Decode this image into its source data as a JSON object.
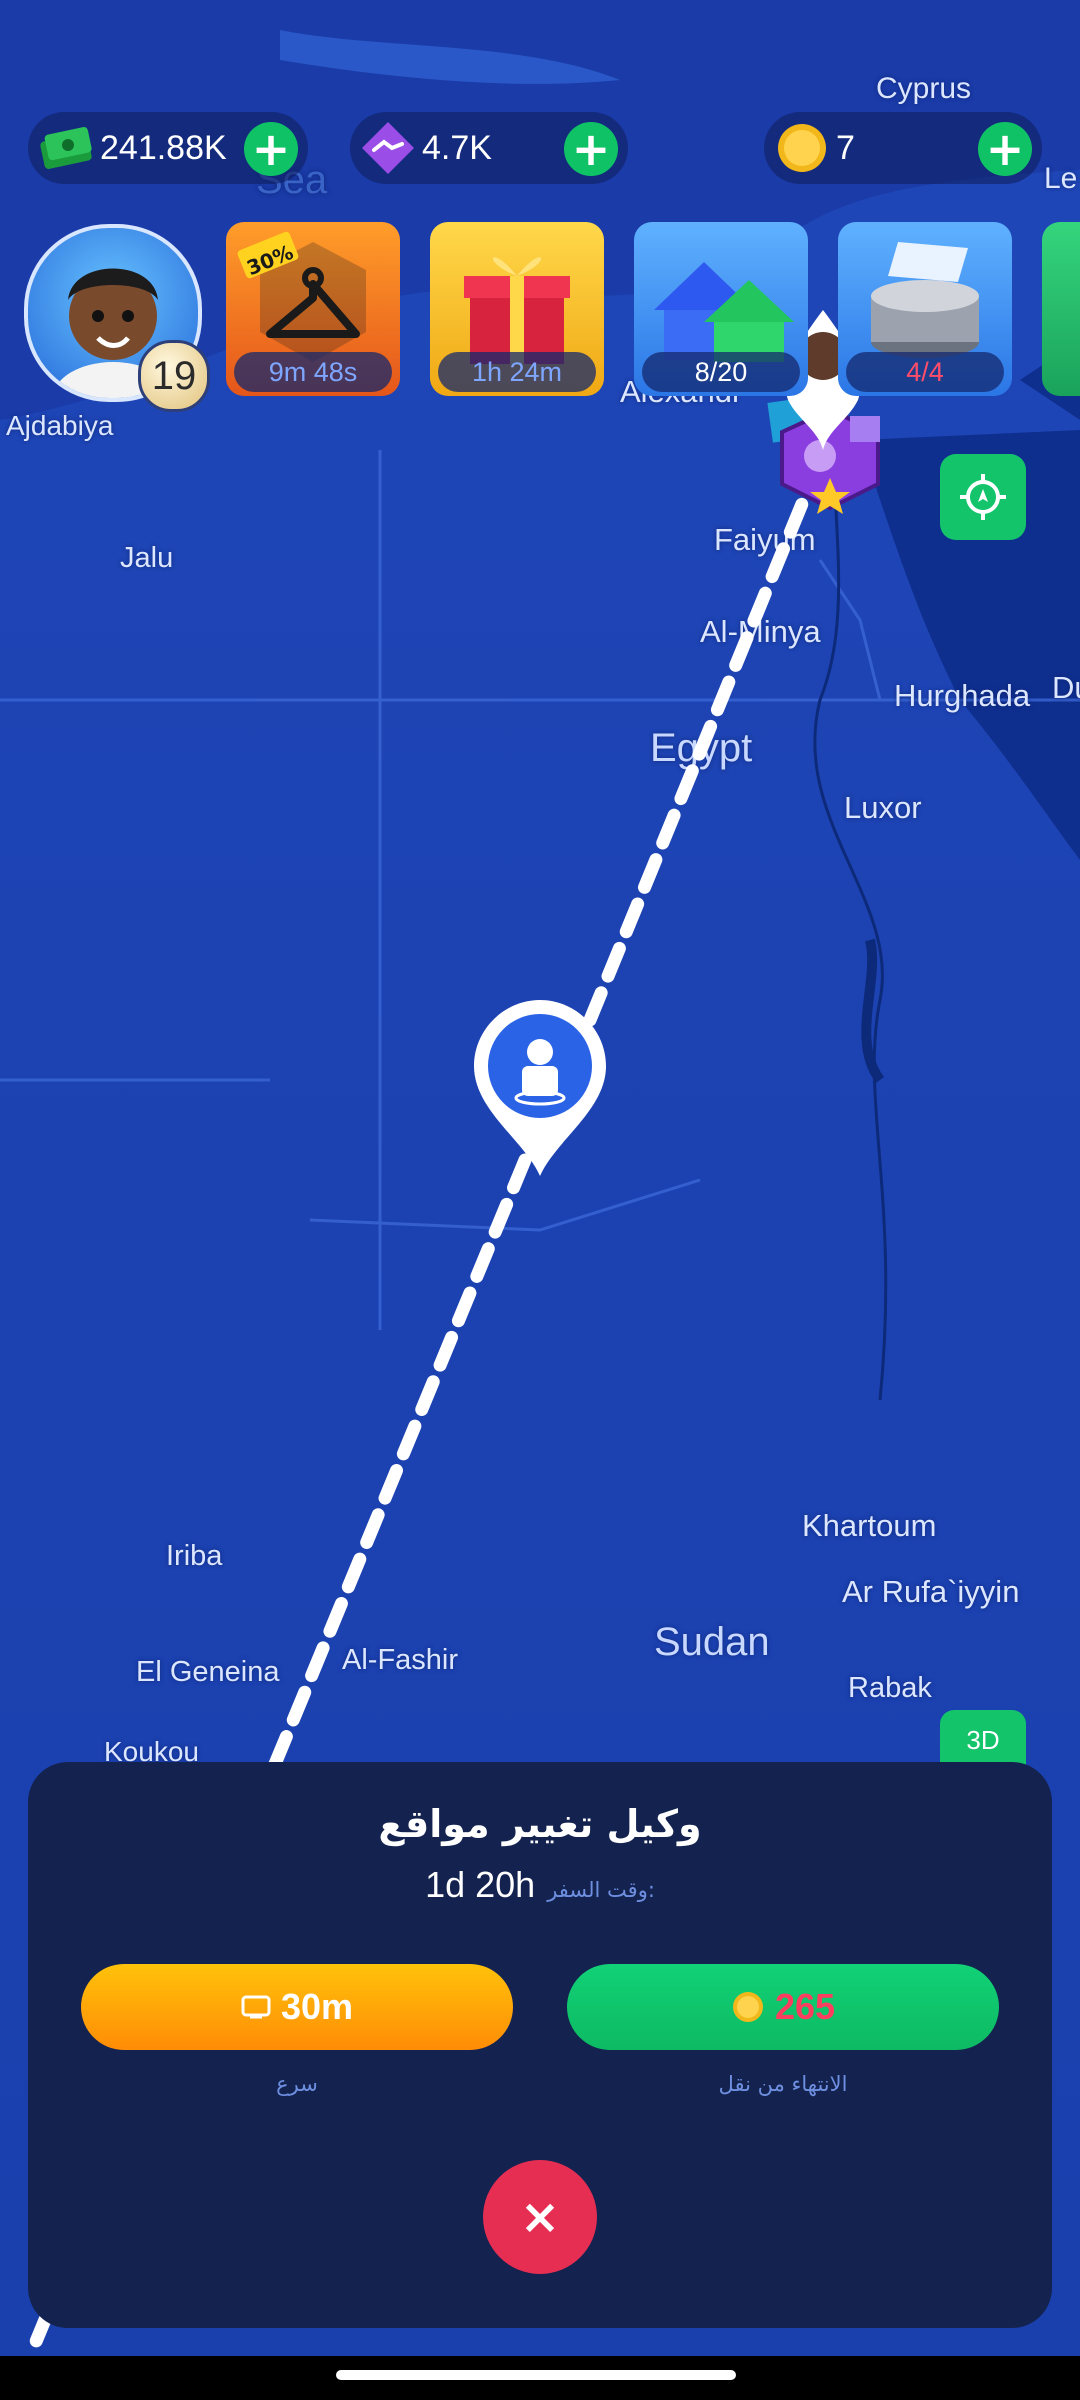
{
  "currencies": {
    "cash": {
      "value": "241.88K",
      "icon": "cash-stack-icon"
    },
    "deals": {
      "value": "4.7K",
      "icon": "handshake-gem-icon"
    },
    "coins": {
      "value": "7",
      "icon": "gold-coin-icon"
    },
    "plus_label": "+"
  },
  "player": {
    "level": "19"
  },
  "cards": [
    {
      "label": "9m 48s",
      "badge": "30%",
      "icon": "hanger-sale-icon"
    },
    {
      "label": "1h 24m",
      "icon": "gift-box-icon"
    },
    {
      "label": "8/20",
      "icon": "houses-icon"
    },
    {
      "label": "4/4",
      "icon": "coin-stack-icon",
      "label_color": "#ff4d6a"
    }
  ],
  "map": {
    "places": [
      {
        "name": "Cyprus"
      },
      {
        "name": "Sea"
      },
      {
        "name": "Ajdabiya"
      },
      {
        "name": "Alexandr"
      },
      {
        "name": "Jalu"
      },
      {
        "name": "Faiyum"
      },
      {
        "name": "Al-Minya"
      },
      {
        "name": "Hurghada"
      },
      {
        "name": "Du"
      },
      {
        "name": "Egypt"
      },
      {
        "name": "Luxor"
      },
      {
        "name": "Khartoum"
      },
      {
        "name": "Ar Rufa`iyyin"
      },
      {
        "name": "Iriba"
      },
      {
        "name": "Sudan"
      },
      {
        "name": "Rabak"
      },
      {
        "name": "El Geneina"
      },
      {
        "name": "Al-Fashir"
      },
      {
        "name": "Koukou"
      },
      {
        "name": "Le"
      }
    ],
    "locate_icon": "crosshair-icon",
    "view_toggle": "3D"
  },
  "sheet": {
    "title": "وكيل تغيير مواقع",
    "travel_time_label": "وقت السفر:",
    "travel_time_value": "1d 20h",
    "speed_button": {
      "value": "30m",
      "icon": "ad-icon"
    },
    "finish_button": {
      "value": "265",
      "icon": "gold-coin-icon",
      "value_color": "#ff3d5f"
    },
    "speed_caption": "سرع",
    "finish_caption": "الانتهاء من نقل",
    "close_label": "×"
  }
}
